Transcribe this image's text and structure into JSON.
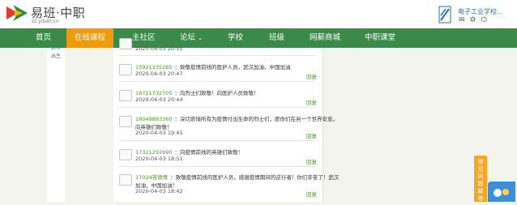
{
  "site": {
    "logo_title": "易班·中职",
    "logo_sub": "zz.yiban.cn",
    "school_name": "电子工业学校...",
    "icons": [
      "mail-icon",
      "gear-icon",
      "power-icon"
    ]
  },
  "nav": {
    "items": [
      {
        "label": "首页"
      },
      {
        "label": "在线课程"
      },
      {
        "label": "主社区"
      },
      {
        "label": "论坛"
      },
      {
        "label": "学校"
      },
      {
        "label": "班级"
      },
      {
        "label": "网薪商城"
      },
      {
        "label": "中职课堂"
      }
    ],
    "dropdown_caret": "⌄"
  },
  "left": {
    "texts": [
      "201",
      "出生"
    ]
  },
  "comments": [
    {
      "name": "",
      "message": "",
      "line2": "",
      "date": "2020-04-03 20:51",
      "reply": ""
    },
    {
      "name": "15921335285",
      "message": "：致敬疫情前线的医护人员，武汉加油，中国加油",
      "line2": "",
      "date": "2020-04-03 20:47",
      "reply": "回复"
    },
    {
      "name": "18721732705",
      "message": "：向烈士们致敬！向医护人员致敬！",
      "line2": "",
      "date": "2020-04-03 20:44",
      "reply": "回复"
    },
    {
      "name": "18049883360",
      "message": "：深切哀悼所有为疫情付出生命的烈士们，愿你们在另一个世界安息，",
      "line2": "向英雄们致敬！",
      "date": "2020-04-03 19:41",
      "reply": "回复"
    },
    {
      "name": "17321292690",
      "message": "：向疫情前线的英雄们致敬！",
      "line2": "",
      "date": "2020-04-03 18:51",
      "reply": "回复"
    },
    {
      "name": "17024蒋德倩",
      "message": "：致敬疫情前线的医护人员，感谢疫情期间的逆行者！你们辛苦了！武汉",
      "line2": "加油，中国加油！",
      "date": "2020-04-03 18:42",
      "reply": "回复"
    }
  ],
  "side_tab": {
    "label": "常见问题解答"
  },
  "colors": {
    "nav": "#3c8a4a",
    "active": "#f09a0e",
    "name": "#4e9a27",
    "tab": "#f5a623",
    "chat": "#3a8fd8"
  }
}
